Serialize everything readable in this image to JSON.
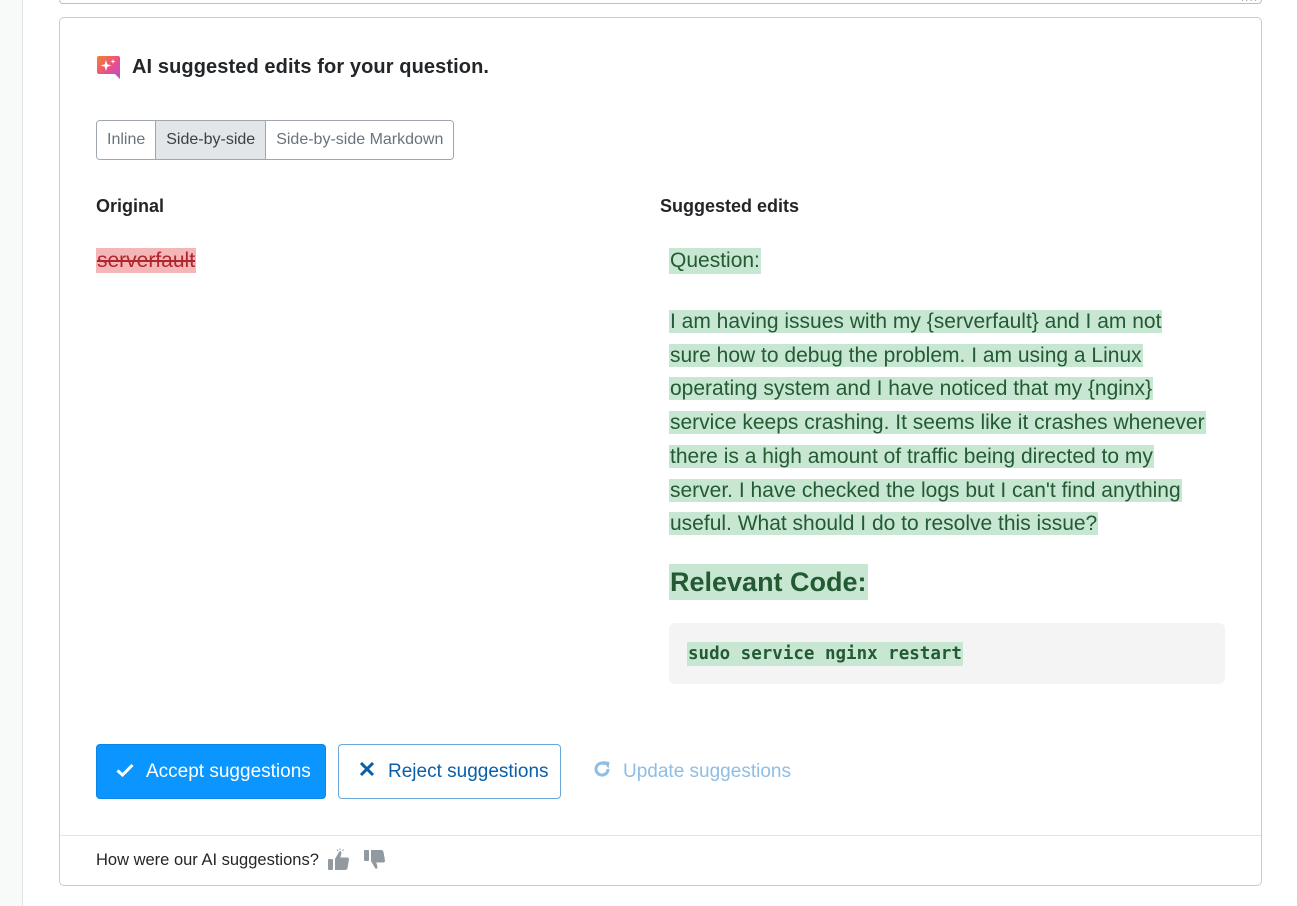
{
  "panel": {
    "title": "AI suggested edits for your question.",
    "icon": "ai-sparkle-icon",
    "brand_gradient": [
      "#f48225",
      "#e94f8a",
      "#b04fd6"
    ]
  },
  "view_tabs": [
    {
      "label": "Inline",
      "active": false
    },
    {
      "label": "Side-by-side",
      "active": true
    },
    {
      "label": "Side-by-side Markdown",
      "active": false
    }
  ],
  "original": {
    "heading": "Original",
    "deleted_text": "serverfault"
  },
  "suggested": {
    "heading": "Suggested edits",
    "question_label": "Question:",
    "paragraph_lines": [
      "I am having issues with my {serverfault} and I am not",
      "sure how to debug the problem. I am using a Linux",
      "operating system and I have noticed that my {nginx}",
      "service keeps crashing. It seems like it crashes whenever",
      "there is a high amount of traffic being directed to my",
      "server. I have checked the logs but I can't find anything",
      "useful. What should I do to resolve this issue?"
    ],
    "code_heading": "Relevant Code:",
    "code": "sudo service nginx restart"
  },
  "actions": {
    "accept": {
      "label": "Accept suggestions",
      "icon": "check-icon",
      "color": "#0a95ff"
    },
    "reject": {
      "label": "Reject suggestions",
      "icon": "x-icon",
      "color": "#0a5fa8"
    },
    "update": {
      "label": "Update suggestions",
      "icon": "refresh-icon",
      "color": "#8fbde3"
    }
  },
  "feedback": {
    "prompt": "How were our AI suggestions?",
    "up_icon": "thumbs-up-icon",
    "down_icon": "thumbs-down-icon"
  },
  "colors": {
    "deleted_bg": "#f5b6b8",
    "deleted_fg": "#b1262e",
    "inserted_bg": "#c8e7d2",
    "inserted_fg": "#235a34"
  }
}
